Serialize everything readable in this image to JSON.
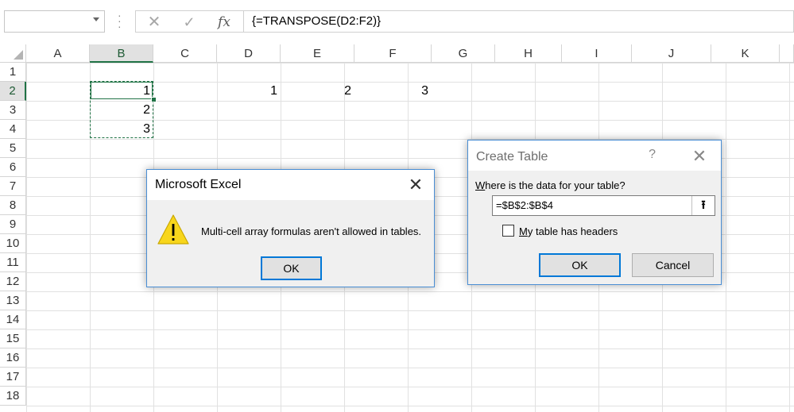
{
  "formula_bar": {
    "name_box_value": "",
    "fx_label": "fx",
    "formula": "{=TRANSPOSE(D2:F2)}"
  },
  "columns": [
    "A",
    "B",
    "C",
    "D",
    "E",
    "F",
    "G",
    "H",
    "I",
    "J",
    "K"
  ],
  "rows": [
    "1",
    "2",
    "3",
    "4",
    "5",
    "6",
    "7",
    "8",
    "9",
    "10",
    "11",
    "12",
    "13",
    "14",
    "15",
    "16",
    "17",
    "18"
  ],
  "selected_column": "B",
  "selected_row": "2",
  "cells": {
    "B2": "1",
    "B3": "2",
    "B4": "3",
    "D2": "1",
    "E2": "2",
    "F2": "3"
  },
  "excel_dialog": {
    "title": "Microsoft Excel",
    "message": "Multi-cell array formulas aren't allowed in tables.",
    "ok_label": "OK"
  },
  "create_table_dialog": {
    "title": "Create Table",
    "help_label": "?",
    "question_accel": "W",
    "question_rest": "here is the data for your table?",
    "range_value": "=$B$2:$B$4",
    "checkbox_accel": "M",
    "checkbox_rest": "y table has headers",
    "checkbox_checked": false,
    "ok_label": "OK",
    "cancel_label": "Cancel"
  },
  "colors": {
    "accent": "#217346",
    "dialog_border": "#4a8ed4",
    "default_button_border": "#0078d7",
    "warning_yellow": "#f8d61c"
  }
}
